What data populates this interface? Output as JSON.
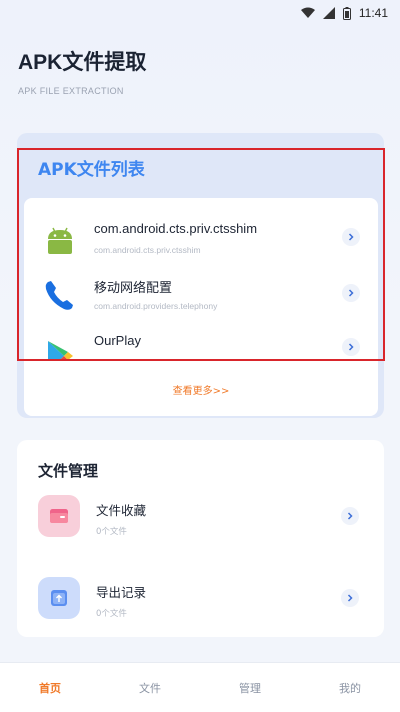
{
  "status_bar": {
    "time": "11:41"
  },
  "header": {
    "title": "APK文件提取",
    "subtitle": "APK FILE EXTRACTION"
  },
  "apk_list": {
    "title": "APK文件列表",
    "items": [
      {
        "name": "com.android.cts.priv.ctsshim",
        "package": "com.android.cts.priv.ctsshim",
        "icon": "android-robot-icon"
      },
      {
        "name": "移动网络配置",
        "package": "com.android.providers.telephony",
        "icon": "phone-icon"
      },
      {
        "name": "OurPlay",
        "package": "",
        "icon": "play-triangle-icon"
      }
    ],
    "see_more": "查看更多>>"
  },
  "file_management": {
    "title": "文件管理",
    "items": [
      {
        "label": "文件收藏",
        "count": "0个文件",
        "icon": "folder-icon",
        "color": "#f8c9d6"
      },
      {
        "label": "导出记录",
        "count": "0个文件",
        "icon": "export-icon",
        "color": "#c9d9fb"
      }
    ]
  },
  "bottom_nav": {
    "items": [
      {
        "label": "首页",
        "active": true
      },
      {
        "label": "文件",
        "active": false
      },
      {
        "label": "管理",
        "active": false
      },
      {
        "label": "我的",
        "active": false
      }
    ]
  },
  "colors": {
    "accent_blue": "#3e86f0",
    "accent_orange": "#f07a2a",
    "highlight_red": "#d9252b"
  }
}
